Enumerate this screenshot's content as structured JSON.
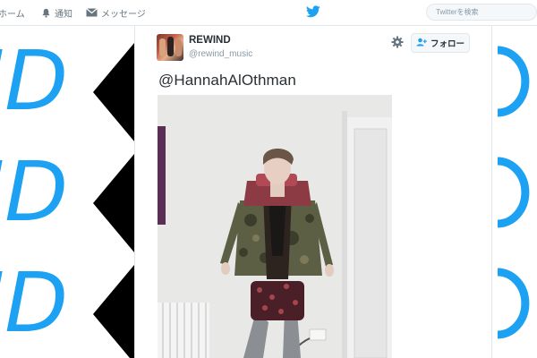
{
  "topnav": {
    "home_label": "ホーム",
    "notifications_label": "通知",
    "messages_label": "メッセージ",
    "search_placeholder": "Twitterを検索"
  },
  "background": {
    "logo_text": "ID",
    "brand_color": "#1da1f2"
  },
  "tweet": {
    "display_name": "REWIND",
    "screen_name": "@rewind_music",
    "follow_label": "フォロー",
    "text": "@HannahAlOthman"
  },
  "colors": {
    "accent": "#1da1f2",
    "text_primary": "#292f33",
    "text_secondary": "#8899a6"
  }
}
